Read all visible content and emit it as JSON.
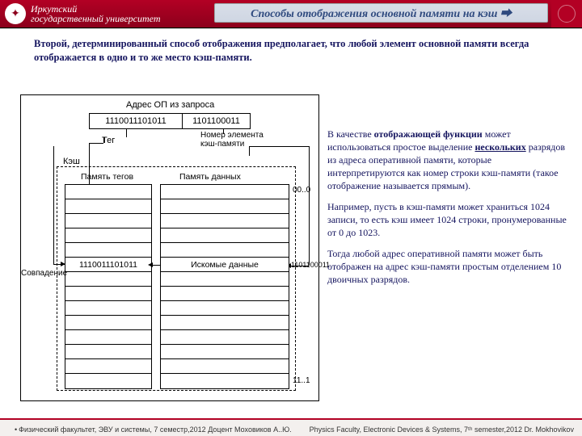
{
  "header": {
    "uni_line1": "Иркутский",
    "uni_line2": "государственный университет",
    "title": "Способы отображения основной памяти на кэш ⮕"
  },
  "intro": "Второй, детерминированный способ отображения предполагает, что любой элемент основной памяти всегда отображается в одно и то же место кэш-памяти.",
  "diagram": {
    "addr_title": "Адрес ОП из запроса",
    "addr_a": "1110011101011",
    "addr_b": "1101100011",
    "tag": "Тег",
    "num_elem": "Номер элемента\nкэш-памяти",
    "cache": "Кэш",
    "tag_mem": "Память тегов",
    "data_mem": "Память данных",
    "tag_row": "1110011101011",
    "data_row": "Искомые данные",
    "match": "Совпадение",
    "idx_top": "00..0",
    "idx_cur": "1101100011",
    "idx_bot": "11..1"
  },
  "rcol": {
    "p1_a": "В качестве ",
    "p1_b": "отображающей функции",
    "p1_c": " может использоваться простое выделение ",
    "p1_d": "нескольких",
    "p1_e": " разрядов из адреса оперативной памяти, которые интерпретируются как номер строки кэш-памяти (такое отображение называется прямым).",
    "p2": "Например, пусть в кэш-памяти может храниться 1024 записи, то есть кэш имеет 1024 строки, пронумерованные от 0 до 1023.",
    "p3": "Тогда любой адрес оперативной памяти может быть отображен на адрес кэш-памяти простым отделением 10 двоичных разрядов."
  },
  "footer": {
    "left": "Физический факультет, ЭВУ и системы, 7 семестр,2012 Доцент Моховиков А..Ю.",
    "right": "Physics Faculty, Electronic Devices & Systems, 7ᵗʰ semester,2012  Dr. Mokhovikov"
  }
}
